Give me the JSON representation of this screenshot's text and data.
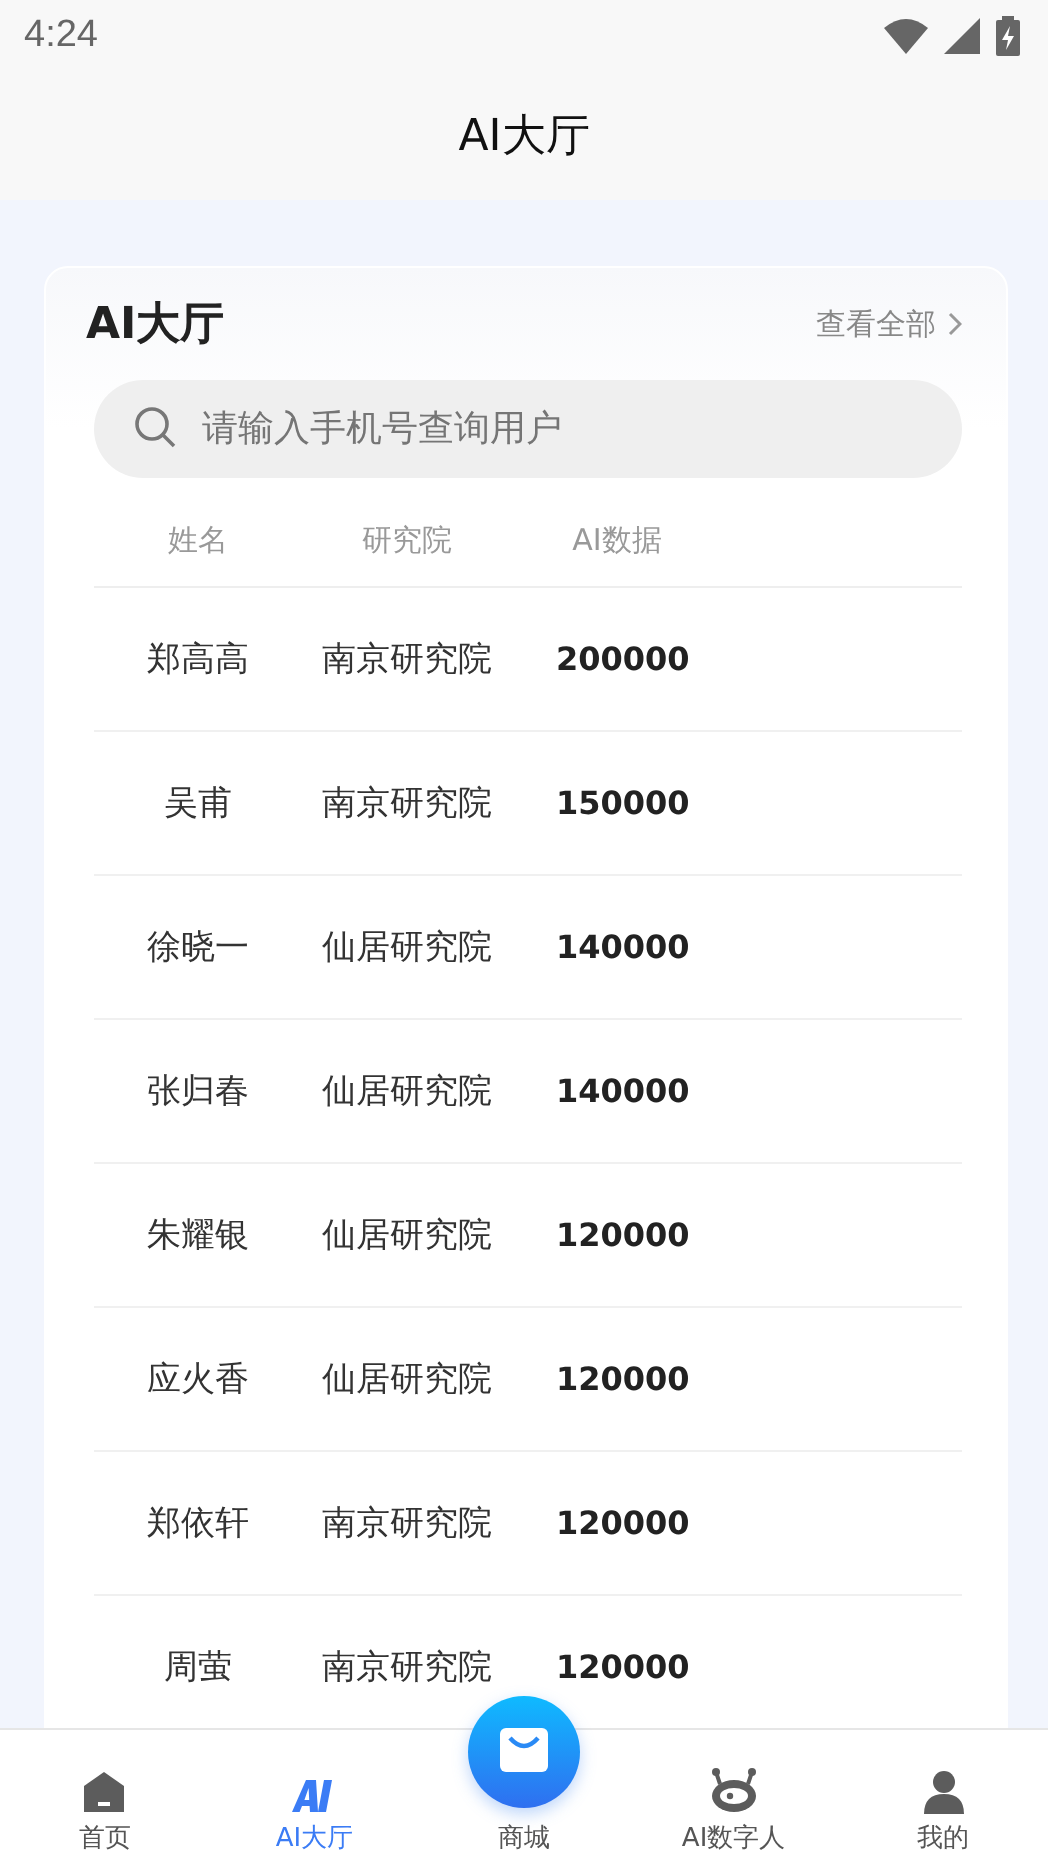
{
  "status_bar": {
    "time": "4:24"
  },
  "header": {
    "title": "AI大厅"
  },
  "card": {
    "title": "AI大厅",
    "view_all": "查看全部",
    "search": {
      "placeholder": "请输入手机号查询用户"
    },
    "columns": [
      "姓名",
      "研究院",
      "AI数据"
    ],
    "rows": [
      {
        "name": "郑高高",
        "institute": "南京研究院",
        "ai_data": "200000"
      },
      {
        "name": "吴甫",
        "institute": "南京研究院",
        "ai_data": "150000"
      },
      {
        "name": "徐晓一",
        "institute": "仙居研究院",
        "ai_data": "140000"
      },
      {
        "name": "张归春",
        "institute": "仙居研究院",
        "ai_data": "140000"
      },
      {
        "name": "朱耀银",
        "institute": "仙居研究院",
        "ai_data": "120000"
      },
      {
        "name": "应火香",
        "institute": "仙居研究院",
        "ai_data": "120000"
      },
      {
        "name": "郑依轩",
        "institute": "南京研究院",
        "ai_data": "120000"
      },
      {
        "name": "周萤",
        "institute": "南京研究院",
        "ai_data": "120000"
      }
    ]
  },
  "tab_bar": [
    {
      "label": "首页",
      "kind": "home",
      "selected": false
    },
    {
      "label": "AI大厅",
      "kind": "ai",
      "selected": true
    },
    {
      "label": "商城",
      "kind": "shop",
      "selected": false
    },
    {
      "label": "AI数字人",
      "kind": "robot",
      "selected": false
    },
    {
      "label": "我的",
      "kind": "person",
      "selected": false
    }
  ]
}
